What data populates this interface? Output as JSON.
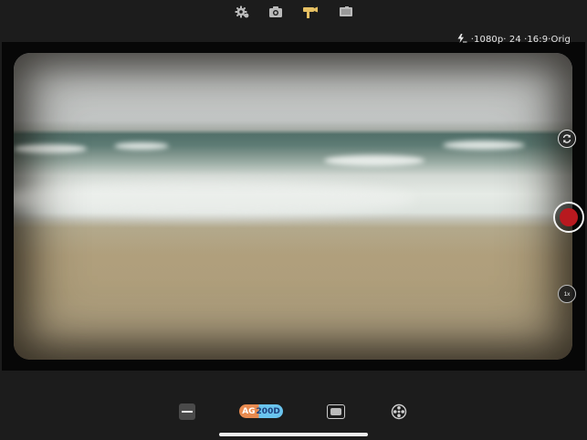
{
  "topbar": {
    "icons": [
      "settings-icon",
      "camera-icon",
      "video-camera-icon",
      "film-roll-icon"
    ],
    "active": "video-camera-icon"
  },
  "status": {
    "flash_icon": "flash-auto-icon",
    "text": "·1080p· 24 ·16:9·Orig"
  },
  "viewfinder": {
    "scene": "beach waves"
  },
  "controls": {
    "flip_icon": "camera-flip-icon",
    "record_icon": "record-icon",
    "record_color": "#b8191f",
    "zoom_label": "1x"
  },
  "bottombar": {
    "exposure_icon": "exposure-icon",
    "film_badge": {
      "part1": "AG",
      "part2": "200D"
    },
    "frame_icon": "frame-icon",
    "reel_icon": "film-reel-icon"
  }
}
